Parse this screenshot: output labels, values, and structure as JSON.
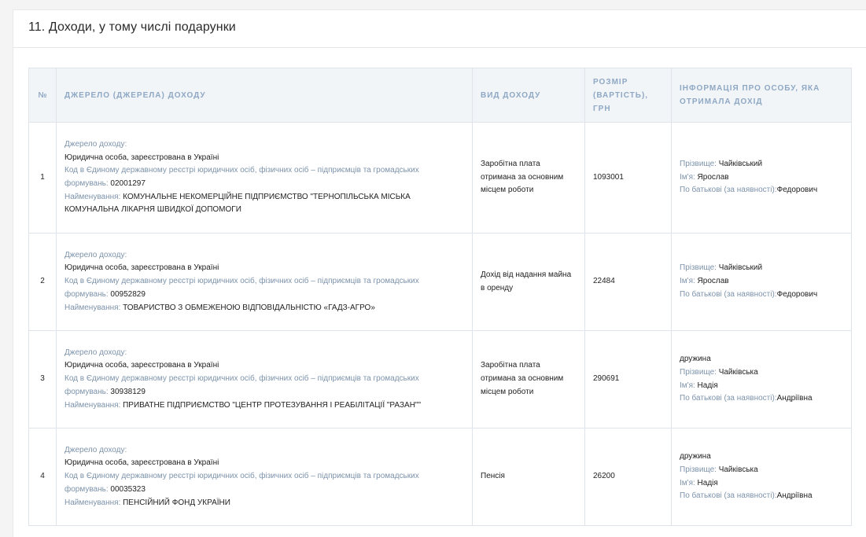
{
  "section": {
    "title": "11. Доходи, у тому числі подарунки"
  },
  "table": {
    "headers": {
      "num": "№",
      "source": "ДЖЕРЕЛО (ДЖЕРЕЛА) ДОХОДУ",
      "type": "ВИД ДОХОДУ",
      "amount": "РОЗМІР (ВАРТІСТЬ), ГРН",
      "person": "ІНФОРМАЦІЯ ПРО ОСОБУ, ЯКА ОТРИМАЛА ДОХІД"
    },
    "labels": {
      "source_heading": "Джерело доходу:",
      "code_label_part1": "Код в Єдиному державному реєстрі юридичних осіб, фізичних осіб – підприємців та громадських",
      "code_label_part2": "формувань:",
      "name_label": "Найменування:",
      "surname_label": "Прізвище:",
      "first_name_label": "Ім'я:",
      "patronymic_label": "По батькові (за наявності):"
    },
    "rows": [
      {
        "num": "1",
        "entity_type": "Юридична особа, зареєстрована в Україні",
        "code": "02001297",
        "name": "КОМУНАЛЬНЕ НЕКОМЕРЦІЙНЕ ПІДПРИЄМСТВО \"ТЕРНОПІЛЬСЬКА МІСЬКА КОМУНАЛЬНА ЛІКАРНЯ ШВИДКОЇ ДОПОМОГИ",
        "income_type": "Заробітна плата отримана за основним місцем роботи",
        "amount": "1093001",
        "relation": "",
        "surname": "Чайківський",
        "first_name": "Ярослав",
        "patronymic": "Федорович"
      },
      {
        "num": "2",
        "entity_type": "Юридична особа, зареєстрована в Україні",
        "code": "00952829",
        "name": "ТОВАРИСТВО З ОБМЕЖЕНОЮ ВІДПОВІДАЛЬНІСТЮ «ГАДЗ-АГРО»",
        "income_type": "Дохід від надання майна в оренду",
        "amount": "22484",
        "relation": "",
        "surname": "Чайківський",
        "first_name": "Ярослав",
        "patronymic": "Федорович"
      },
      {
        "num": "3",
        "entity_type": "Юридична особа, зареєстрована в Україні",
        "code": "30938129",
        "name": "ПРИВАТНЕ ПІДПРИЄМСТВО \"ЦЕНТР ПРОТЕЗУВАННЯ І РЕАБІЛІТАЦІЇ \"РАЗАН\"\"",
        "income_type": "Заробітна плата отримана за основним місцем роботи",
        "amount": "290691",
        "relation": "дружина",
        "surname": "Чайківська",
        "first_name": "Надія",
        "patronymic": "Андріївна"
      },
      {
        "num": "4",
        "entity_type": "Юридична особа, зареєстрована в Україні",
        "code": "00035323",
        "name": "ПЕНСІЙНИЙ ФОНД УКРАЇНИ",
        "income_type": "Пенсія",
        "amount": "26200",
        "relation": "дружина",
        "surname": "Чайківська",
        "first_name": "Надія",
        "patronymic": "Андріївна"
      }
    ]
  }
}
